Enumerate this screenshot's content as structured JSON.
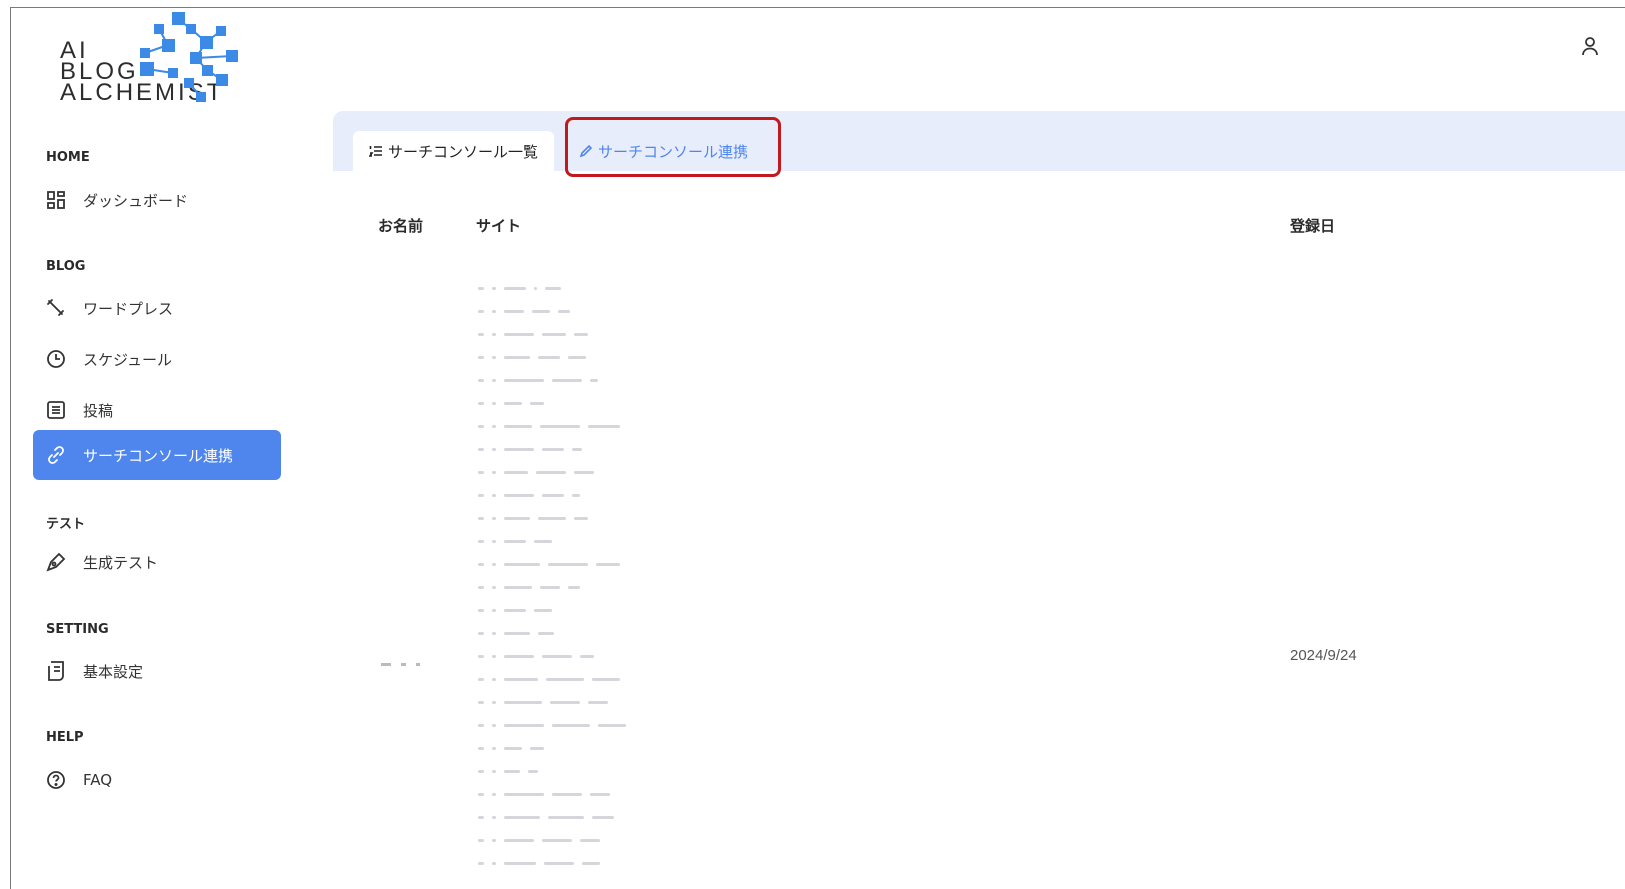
{
  "logo": {
    "line1": "AI",
    "line2": "BLOG",
    "line3": "ALCHEMIST",
    "accent": "#3b8ae6"
  },
  "header": {
    "user_icon": "user-icon"
  },
  "sidebar": {
    "sections": [
      {
        "label": "HOME",
        "items": [
          {
            "label": "ダッシュボード",
            "icon": "dashboard-icon"
          }
        ]
      },
      {
        "label": "BLOG",
        "items": [
          {
            "label": "ワードプレス",
            "icon": "wrench-icon"
          },
          {
            "label": "スケジュール",
            "icon": "clock-icon"
          },
          {
            "label": "投稿",
            "icon": "list-icon"
          },
          {
            "label": "サーチコンソール連携",
            "icon": "link-icon",
            "active": true
          }
        ]
      },
      {
        "label": "テスト",
        "items": [
          {
            "label": "生成テスト",
            "icon": "pen-icon"
          }
        ]
      },
      {
        "label": "SETTING",
        "items": [
          {
            "label": "基本設定",
            "icon": "document-icon"
          }
        ]
      },
      {
        "label": "HELP",
        "items": [
          {
            "label": "FAQ",
            "icon": "question-icon"
          }
        ]
      }
    ],
    "active_color": "#4f86ee"
  },
  "tabs": [
    {
      "label": "サーチコンソール一覧",
      "icon": "list-ordered-icon",
      "active": true
    },
    {
      "label": "サーチコンソール連携",
      "icon": "edit-icon",
      "active": false
    }
  ],
  "table": {
    "columns": [
      "お名前",
      "サイト",
      "登録日"
    ],
    "rows": [
      {
        "date": "2024/9/24"
      }
    ]
  },
  "colors": {
    "tabbar_bg": "#e8edfc",
    "highlight_border": "#c0191e",
    "link": "#4f86ee"
  }
}
